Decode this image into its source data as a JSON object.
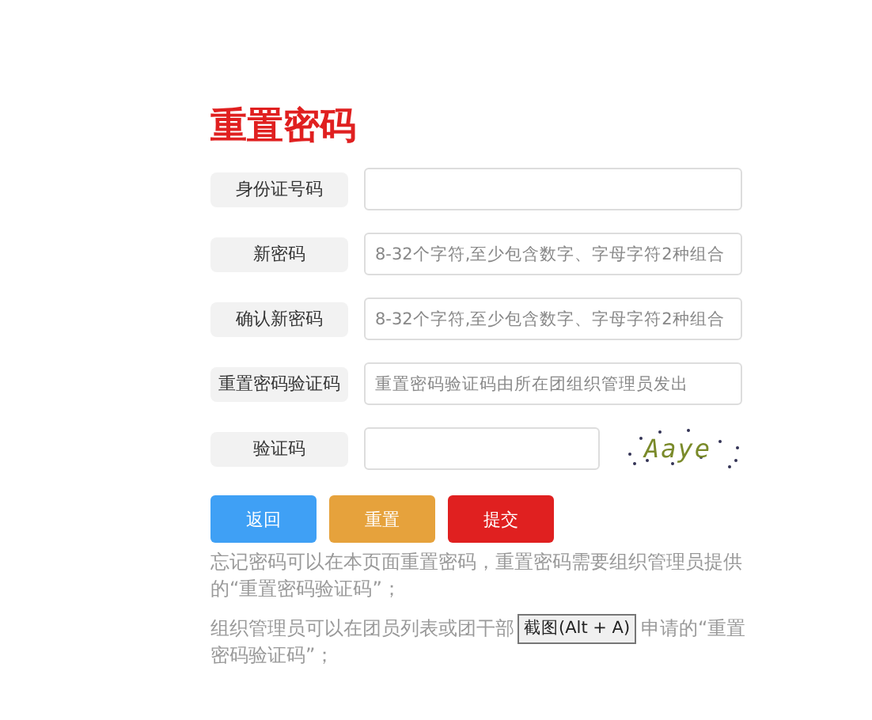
{
  "title": "重置密码",
  "fields": [
    {
      "label": "身份证号码"
    },
    {
      "label": "新密码",
      "placeholder": "8-32个字符,至少包含数字、字母字符2种组合"
    },
    {
      "label": "确认新密码",
      "placeholder": "8-32个字符,至少包含数字、字母字符2种组合"
    },
    {
      "label": "重置密码验证码",
      "placeholder": "重置密码验证码由所在团组织管理员发出"
    }
  ],
  "captcha_field": {
    "label": "验证码",
    "captcha": "Aaye"
  },
  "buttons": [
    {
      "label": "返回",
      "kind": "back"
    },
    {
      "label": "重置",
      "kind": "reset"
    },
    {
      "label": "提交",
      "kind": "submit"
    }
  ],
  "notes": [
    [
      [
        "忘记密码可以在本页面重置密码，重置密码需要组织管理员提供"
      ],
      [
        "的“重置密码验证码”；"
      ]
    ],
    [
      [
        "组织管理员可以在团员列表或团干部",
        "申请的“重置"
      ],
      [
        "密码验证码”；"
      ]
    ]
  ],
  "tooltip": "截图(Alt + A)"
}
